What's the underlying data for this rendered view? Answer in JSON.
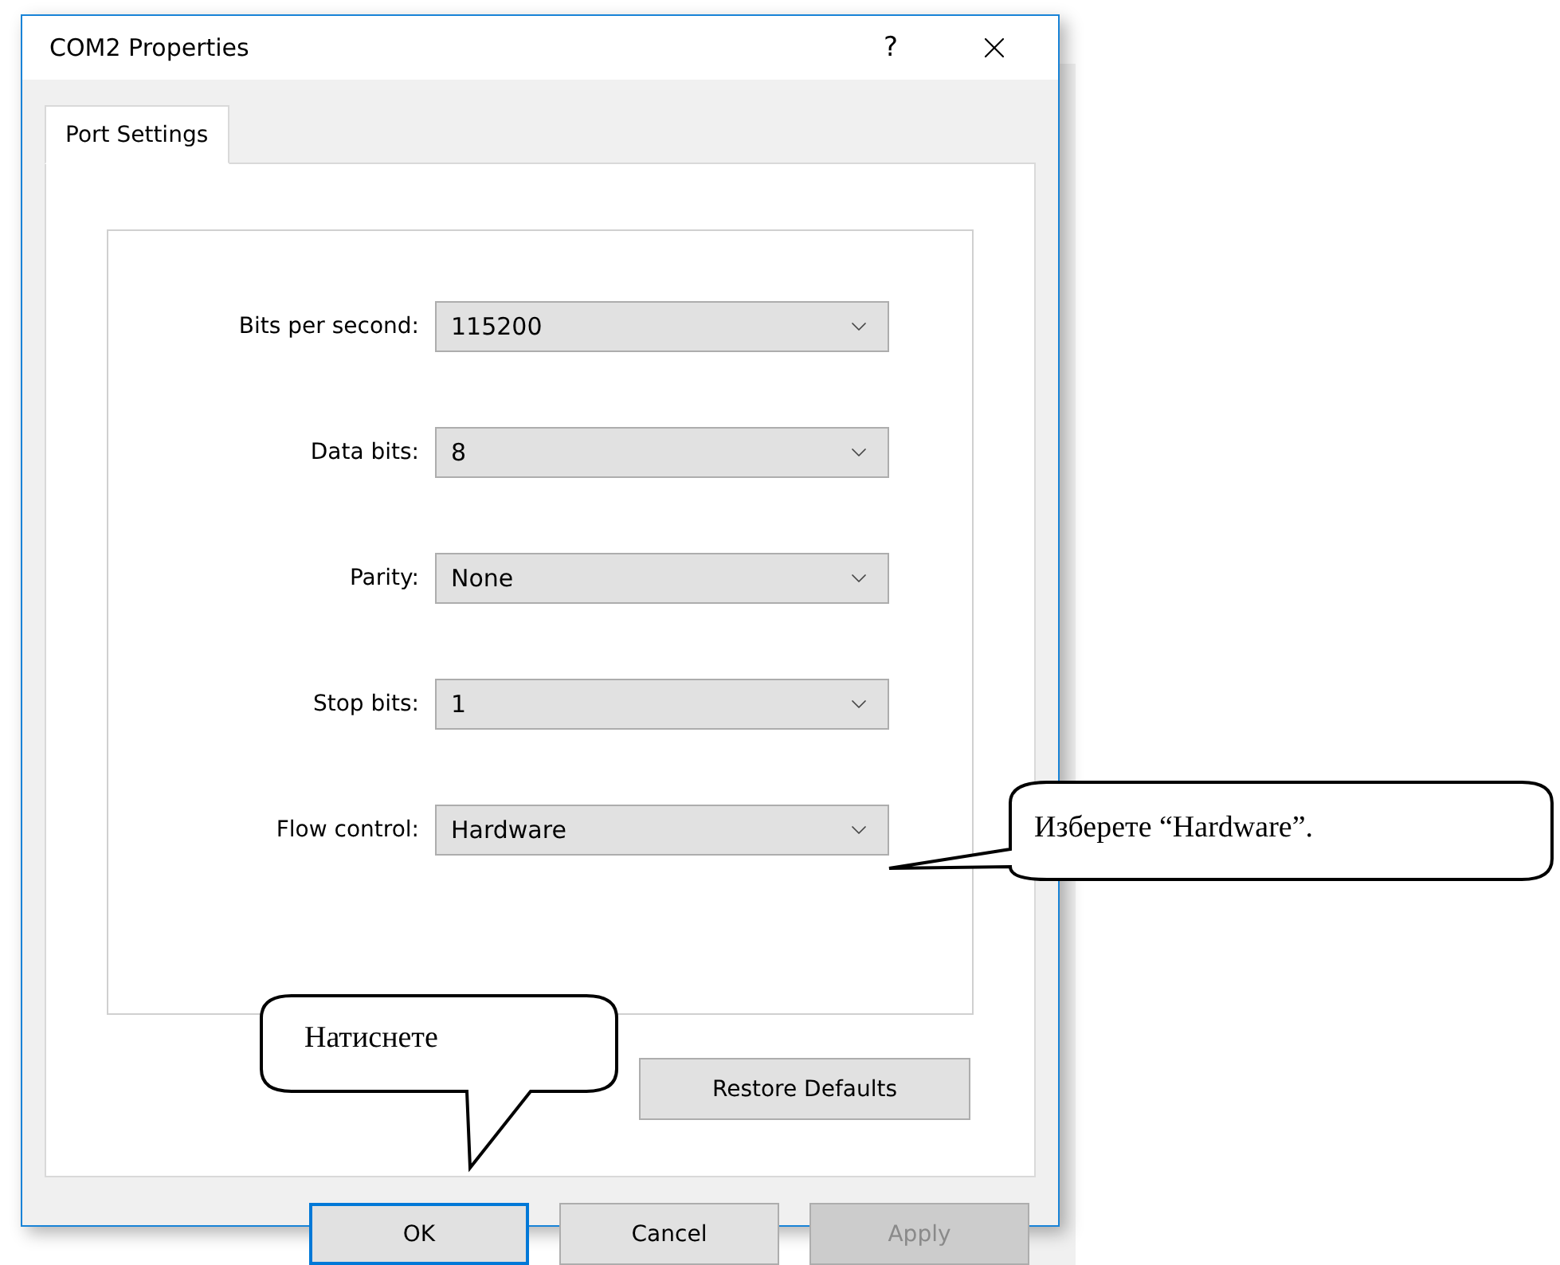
{
  "window": {
    "title": "COM2 Properties",
    "help": "?"
  },
  "tabs": [
    {
      "label": "Port Settings",
      "selected": true
    }
  ],
  "fields": [
    {
      "label": "Bits per second:",
      "value": "115200"
    },
    {
      "label": "Data bits:",
      "value": "8"
    },
    {
      "label": "Parity:",
      "value": "None"
    },
    {
      "label": "Stop bits:",
      "value": "1"
    },
    {
      "label": "Flow control:",
      "value": "Hardware"
    }
  ],
  "restore_button": {
    "label": "Restore Defaults",
    "disabled": false
  },
  "buttons": [
    {
      "label": "OK",
      "default": true,
      "disabled": false
    },
    {
      "label": "Cancel",
      "default": false,
      "disabled": false
    },
    {
      "label": "Apply",
      "default": false,
      "disabled": true
    }
  ],
  "callouts": [
    {
      "kind": "down",
      "text": "Натиснете"
    },
    {
      "kind": "left",
      "text": "Изберете “Hardware”."
    }
  ]
}
